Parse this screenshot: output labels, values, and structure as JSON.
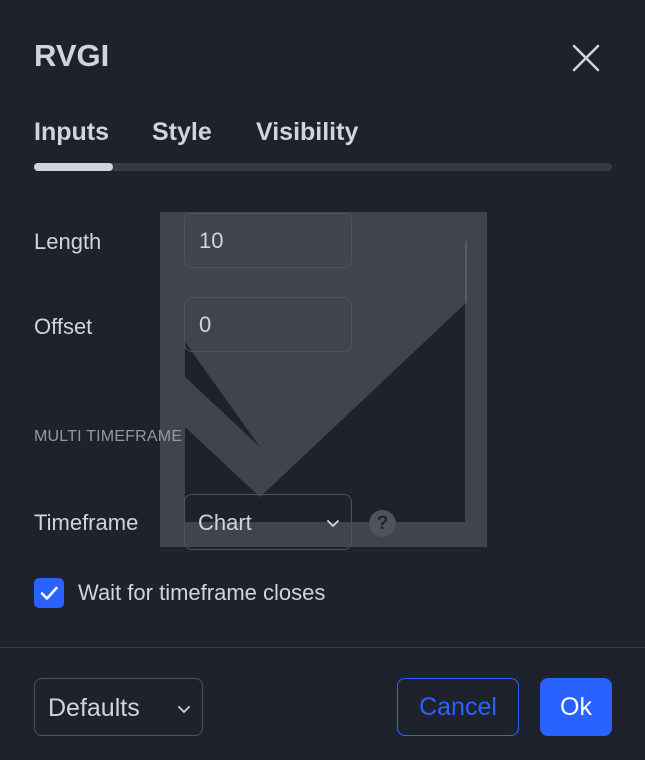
{
  "dialog": {
    "title": "RVGI",
    "close_icon": "close-icon"
  },
  "tabs": [
    {
      "label": "Inputs",
      "active": true
    },
    {
      "label": "Style",
      "active": false
    },
    {
      "label": "Visibility",
      "active": false
    }
  ],
  "inputs": {
    "length": {
      "label": "Length",
      "value": "10"
    },
    "offset": {
      "label": "Offset",
      "value": "0"
    }
  },
  "multi_timeframe": {
    "header": "MULTI TIMEFRAME",
    "timeframe": {
      "label": "Timeframe",
      "value": "Chart",
      "help_icon": "question-circle-icon"
    },
    "wait_for_close": {
      "label": "Wait for timeframe closes",
      "checked": true
    }
  },
  "footer": {
    "defaults_label": "Defaults",
    "cancel_label": "Cancel",
    "ok_label": "Ok"
  },
  "colors": {
    "background": "#1e222d",
    "text": "#d1d4dc",
    "muted": "#9598a1",
    "border": "#50535e",
    "accent": "#2962ff",
    "watermark": "#8a8d96"
  }
}
